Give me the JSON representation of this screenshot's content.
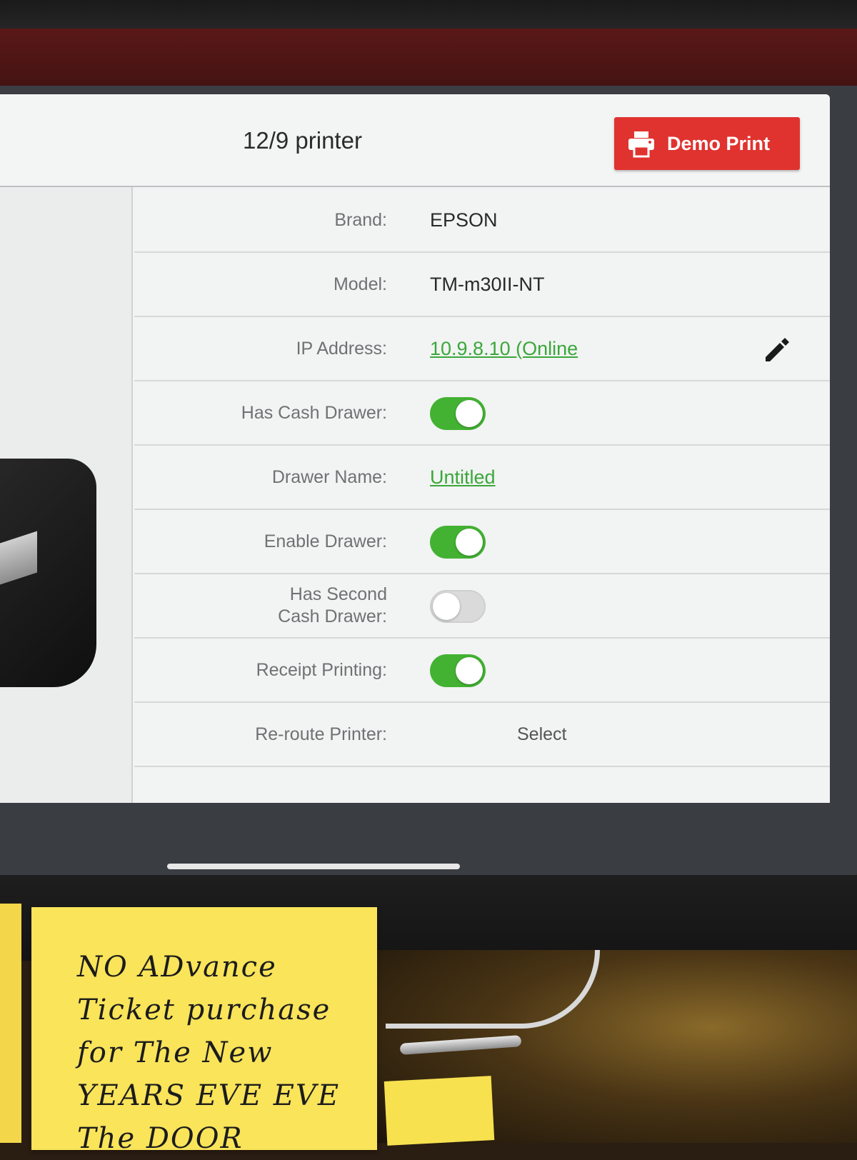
{
  "header": {
    "title": "12/9 printer",
    "demo_print_label": "Demo Print",
    "demo_print_color": "#e0332f"
  },
  "rows": [
    {
      "label": "Brand:",
      "value": "EPSON"
    },
    {
      "label": "Model:",
      "value": "TM-m30II-NT"
    },
    {
      "label": "IP Address:",
      "value": "10.9.8.10 (Online",
      "edit_icon": "pencil-icon"
    },
    {
      "label": "Has Cash Drawer:",
      "toggle": true
    },
    {
      "label": "Drawer Name:",
      "value": "Untitled"
    },
    {
      "label": "Enable Drawer:",
      "toggle": true
    },
    {
      "label_line1": "Has Second",
      "label_line2": "Cash Drawer:",
      "toggle": false
    },
    {
      "label": "Receipt Printing:",
      "toggle": true
    },
    {
      "label": "Re-route Printer:",
      "value": "Select"
    }
  ],
  "colors": {
    "toggle_on": "#43b233",
    "link": "#3aa83a"
  },
  "sticky_note": {
    "lines": [
      "NO ADvance",
      "Ticket purchase",
      "for The New",
      "YEARS EVE EVE",
      "The DOOR"
    ]
  }
}
